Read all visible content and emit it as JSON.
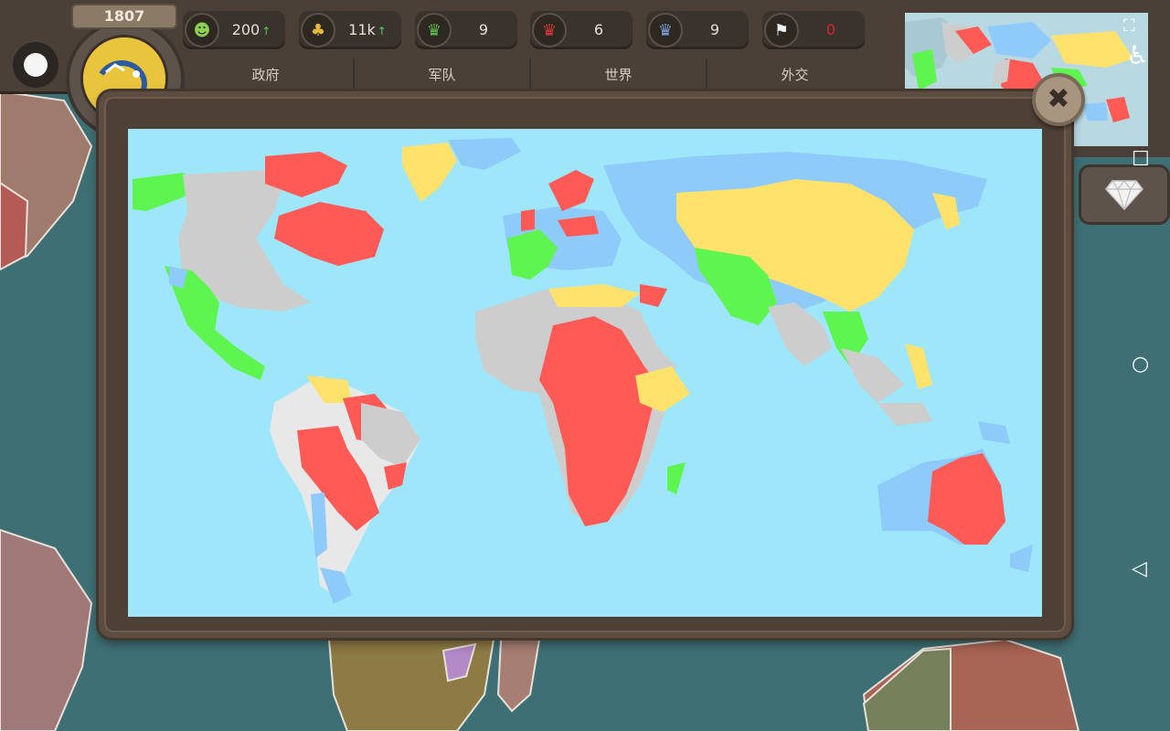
{
  "header": {
    "year": "1807",
    "stats": [
      {
        "icon": "happiness-icon",
        "value": "200",
        "trend": "↑",
        "color": "#8fd14f"
      },
      {
        "icon": "gold-coins-icon",
        "value": "11k",
        "trend": "↑",
        "color": "#e5b83a"
      },
      {
        "icon": "green-crown-icon",
        "value": "9",
        "trend": "",
        "color": "#5fbf4a"
      },
      {
        "icon": "red-crown-icon",
        "value": "6",
        "trend": "",
        "color": "#d9363a"
      },
      {
        "icon": "blue-crown-icon",
        "value": "9",
        "trend": "",
        "color": "#7c9ed6"
      },
      {
        "icon": "flag-icon",
        "value": "0",
        "trend": "",
        "color": "#d9262a"
      }
    ],
    "tabs": [
      "政府",
      "军队",
      "世界",
      "外交"
    ]
  },
  "modal": {
    "close_label": "✖"
  },
  "map_colors": {
    "ocean": "#9ee7fb",
    "red": "#ff5a55",
    "green": "#5ff551",
    "yellow": "#ffe26b",
    "blue": "#8ecbfb",
    "gray": "#cdcdcd"
  },
  "nav": {
    "fullscreen_icon": "fullscreen-icon",
    "accessibility_icon": "accessibility-icon",
    "square_icon": "recents-icon",
    "circle_icon": "home-icon",
    "back_icon": "back-icon"
  }
}
